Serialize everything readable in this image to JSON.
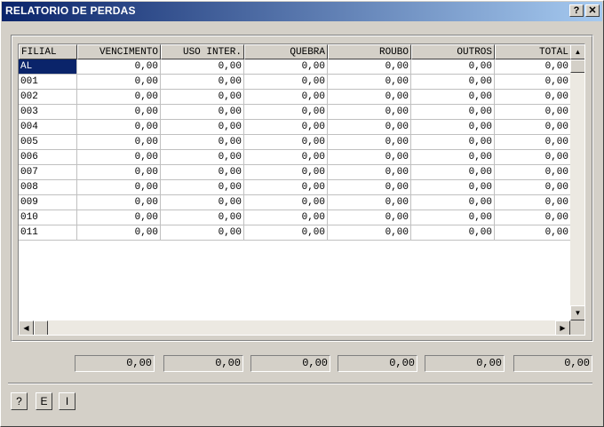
{
  "window": {
    "title": "RELATORIO DE PERDAS",
    "help_btn": "?",
    "close_btn": "✕"
  },
  "table": {
    "columns": [
      "FILIAL",
      "VENCIMENTO",
      "USO INTER.",
      "QUEBRA",
      "ROUBO",
      "OUTROS",
      "TOTAL"
    ],
    "rows": [
      [
        "AL",
        "0,00",
        "0,00",
        "0,00",
        "0,00",
        "0,00",
        "0,00"
      ],
      [
        "001",
        "0,00",
        "0,00",
        "0,00",
        "0,00",
        "0,00",
        "0,00"
      ],
      [
        "002",
        "0,00",
        "0,00",
        "0,00",
        "0,00",
        "0,00",
        "0,00"
      ],
      [
        "003",
        "0,00",
        "0,00",
        "0,00",
        "0,00",
        "0,00",
        "0,00"
      ],
      [
        "004",
        "0,00",
        "0,00",
        "0,00",
        "0,00",
        "0,00",
        "0,00"
      ],
      [
        "005",
        "0,00",
        "0,00",
        "0,00",
        "0,00",
        "0,00",
        "0,00"
      ],
      [
        "006",
        "0,00",
        "0,00",
        "0,00",
        "0,00",
        "0,00",
        "0,00"
      ],
      [
        "007",
        "0,00",
        "0,00",
        "0,00",
        "0,00",
        "0,00",
        "0,00"
      ],
      [
        "008",
        "0,00",
        "0,00",
        "0,00",
        "0,00",
        "0,00",
        "0,00"
      ],
      [
        "009",
        "0,00",
        "0,00",
        "0,00",
        "0,00",
        "0,00",
        "0,00"
      ],
      [
        "010",
        "0,00",
        "0,00",
        "0,00",
        "0,00",
        "0,00",
        "0,00"
      ],
      [
        "011",
        "0,00",
        "0,00",
        "0,00",
        "0,00",
        "0,00",
        "0,00"
      ]
    ],
    "selected_row": 0
  },
  "scroll": {
    "up": "▲",
    "down": "▼",
    "left": "◀",
    "right": "▶"
  },
  "totals": [
    "0,00",
    "0,00",
    "0,00",
    "0,00",
    "0,00",
    "0,00"
  ],
  "buttons": {
    "help": "?",
    "e": "E",
    "i": "I"
  },
  "colors": {
    "title_start": "#0a246a",
    "title_end": "#a6caf0",
    "selection": "#0a246a",
    "face": "#d4d0c8"
  }
}
